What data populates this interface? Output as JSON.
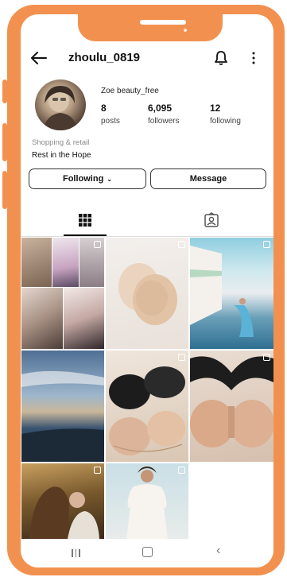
{
  "profile": {
    "username": "zhoulu_0819",
    "display_name": "Zoe beauty_free",
    "category": "Shopping & retail",
    "bio": "Rest in the Hope",
    "stats": [
      {
        "value": "8",
        "label": "posts"
      },
      {
        "value": "6,095",
        "label": "followers"
      },
      {
        "value": "12",
        "label": "following"
      }
    ]
  },
  "actions": {
    "following_label": "Following",
    "following_chevron": "⌄",
    "message_label": "Message"
  },
  "icons": {
    "back": "arrow-left-icon",
    "bell": "bell-icon",
    "more": "more-vertical-icon",
    "grid_tab": "grid-icon",
    "tagged_tab": "tagged-person-icon",
    "nav_recent": "recents-icon",
    "nav_home": "home-icon",
    "nav_back": "back-chevron-icon"
  },
  "nav": {
    "back_glyph": "‹"
  },
  "colors": {
    "frame": "#f2914f",
    "text": "#111111",
    "muted": "#8a8a8a"
  }
}
